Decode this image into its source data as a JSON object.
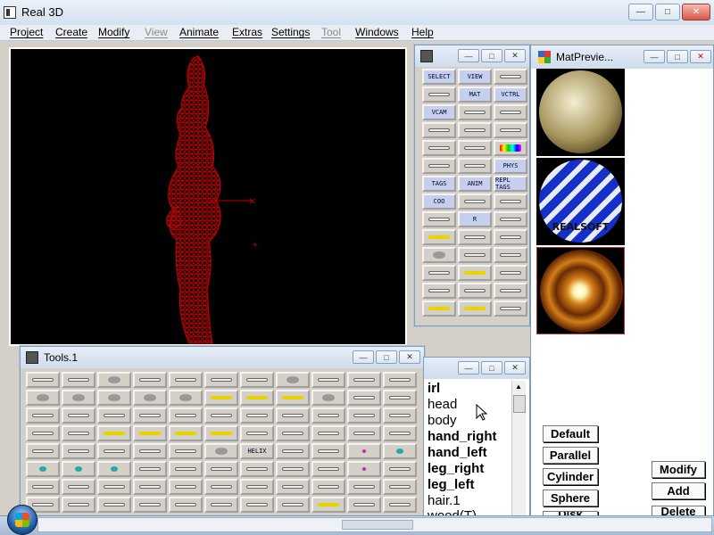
{
  "app": {
    "title": "Real 3D",
    "window_buttons": [
      "minimize",
      "maximize",
      "close"
    ]
  },
  "menu": [
    {
      "label": "Project",
      "enabled": true
    },
    {
      "label": "Create",
      "enabled": true
    },
    {
      "label": "Modify",
      "enabled": true
    },
    {
      "label": "View",
      "enabled": false
    },
    {
      "label": "Animate",
      "enabled": true
    },
    {
      "label": "Extras",
      "enabled": true
    },
    {
      "label": "Settings",
      "enabled": true
    },
    {
      "label": "Tool",
      "enabled": false
    },
    {
      "label": "Windows",
      "enabled": true
    },
    {
      "label": "Help",
      "enabled": true
    }
  ],
  "viewport": {
    "background": "#000000",
    "wireframe_color": "#c00000"
  },
  "tool_palette": {
    "title": "",
    "buttons": [
      {
        "label": "SELECT"
      },
      {
        "label": "VIEW"
      },
      {
        "label": ""
      },
      {
        "label": ""
      },
      {
        "label": "MAT"
      },
      {
        "label": "VCTRL"
      },
      {
        "label": "VCAM"
      },
      {
        "label": ""
      },
      {
        "label": ""
      },
      {
        "label": ""
      },
      {
        "label": ""
      },
      {
        "label": ""
      },
      {
        "label": ""
      },
      {
        "label": ""
      },
      {
        "label": ""
      },
      {
        "label": ""
      },
      {
        "label": ""
      },
      {
        "label": "PHYS"
      },
      {
        "label": "TAGS"
      },
      {
        "label": "ANIM"
      },
      {
        "label": "REPL TAGS"
      },
      {
        "label": "COO"
      },
      {
        "label": ""
      },
      {
        "label": ""
      },
      {
        "label": ""
      },
      {
        "label": "R"
      },
      {
        "label": ""
      },
      {
        "label": ""
      },
      {
        "label": ""
      },
      {
        "label": ""
      },
      {
        "label": ""
      },
      {
        "label": ""
      },
      {
        "label": ""
      },
      {
        "label": ""
      },
      {
        "label": ""
      },
      {
        "label": ""
      },
      {
        "label": ""
      },
      {
        "label": ""
      },
      {
        "label": ""
      },
      {
        "label": ""
      },
      {
        "label": ""
      },
      {
        "label": ""
      }
    ]
  },
  "tools_window": {
    "title": "Tools.1",
    "buttons_per_row": 11,
    "rows": 8,
    "helix_label": "HELIX"
  },
  "material_preview": {
    "title": "MatPrevie...",
    "spheres": [
      {
        "name": "sphere-gold-marble"
      },
      {
        "name": "sphere-blue-logo",
        "label": "REALSOFT"
      },
      {
        "name": "sphere-orange-rings"
      }
    ]
  },
  "object_list": {
    "items": [
      {
        "label": "irl",
        "bold": true
      },
      {
        "label": "head",
        "bold": false
      },
      {
        "label": "body",
        "bold": false
      },
      {
        "label": "hand_right",
        "bold": true
      },
      {
        "label": "hand_left",
        "bold": true
      },
      {
        "label": "leg_right",
        "bold": true
      },
      {
        "label": "leg_left",
        "bold": true
      },
      {
        "label": "hair.1",
        "bold": false
      },
      {
        "label": "wood(T)",
        "bold": false
      }
    ]
  },
  "projection_buttons": [
    "Default",
    "Parallel",
    "Cylinder",
    "Sphere",
    "Disk"
  ],
  "edit_buttons": [
    "Modify",
    "Add",
    "Delete"
  ]
}
